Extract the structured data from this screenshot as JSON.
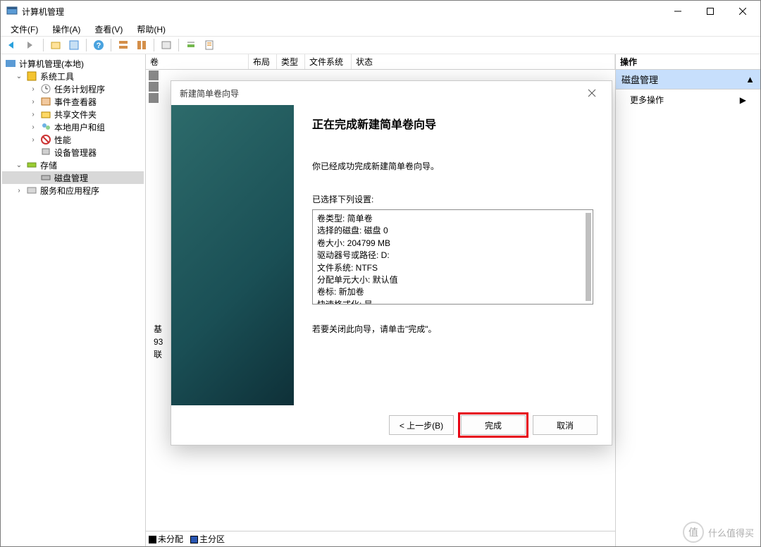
{
  "window": {
    "title": "计算机管理"
  },
  "menu": {
    "file": "文件(F)",
    "action": "操作(A)",
    "view": "查看(V)",
    "help": "帮助(H)"
  },
  "tree": {
    "root": "计算机管理(本地)",
    "systools": "系统工具",
    "tasksched": "任务计划程序",
    "eventviewer": "事件查看器",
    "shared": "共享文件夹",
    "localusers": "本地用户和组",
    "perf": "性能",
    "devmgr": "设备管理器",
    "storage": "存储",
    "diskmgmt": "磁盘管理",
    "services": "服务和应用程序"
  },
  "cols": {
    "volume": "卷",
    "layout": "布局",
    "type": "类型",
    "fs": "文件系统",
    "status": "状态"
  },
  "diskinfo": {
    "l1": "基",
    "l2": "93",
    "l3": "联"
  },
  "legend": {
    "unalloc": "未分配",
    "primary": "主分区"
  },
  "actions": {
    "header": "操作",
    "section": "磁盘管理",
    "more": "更多操作"
  },
  "dialog": {
    "title": "新建简单卷向导",
    "heading": "正在完成新建简单卷向导",
    "success": "你已经成功完成新建简单卷向导。",
    "settings_label": "已选择下列设置:",
    "summary": {
      "l1": "卷类型: 简单卷",
      "l2": "选择的磁盘: 磁盘 0",
      "l3": "卷大小: 204799 MB",
      "l4": "驱动器号或路径: D:",
      "l5": "文件系统: NTFS",
      "l6": "分配单元大小: 默认值",
      "l7": "卷标: 新加卷",
      "l8": "快速格式化: 是"
    },
    "close_hint": "若要关闭此向导，请单击\"完成\"。",
    "back": "< 上一步(B)",
    "finish": "完成",
    "cancel": "取消"
  },
  "watermark": {
    "char": "值",
    "text": "什么值得买"
  }
}
